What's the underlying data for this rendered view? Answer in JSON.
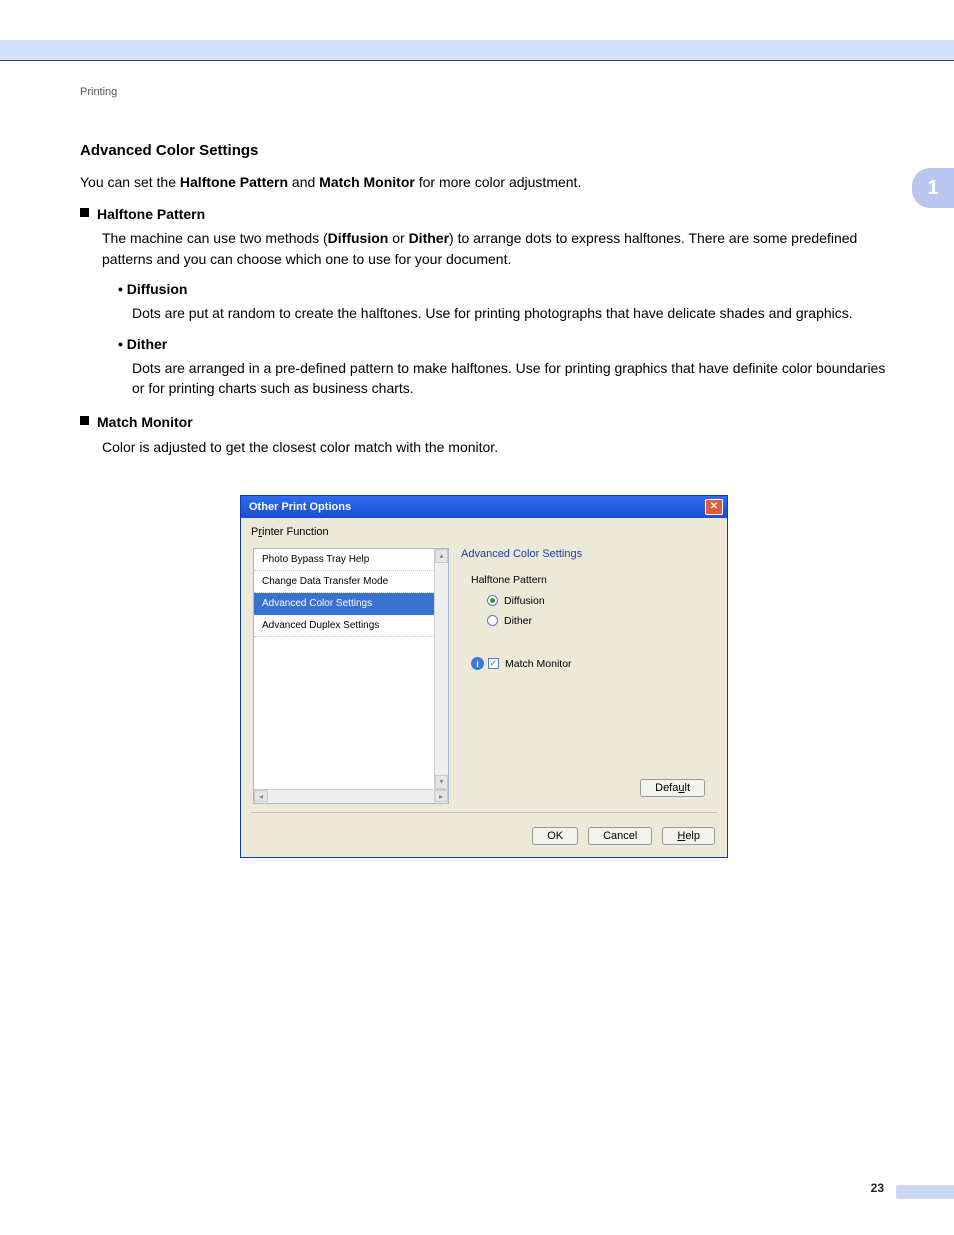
{
  "breadcrumb": "Printing",
  "chapter_badge": "1",
  "page_number": "23",
  "title": "Advanced Color Settings",
  "intro_pre": "You can set the ",
  "intro_b1": "Halftone Pattern",
  "intro_mid": " and ",
  "intro_b2": "Match Monitor",
  "intro_post": " for more color adjustment.",
  "sections": {
    "halftone": {
      "label": "Halftone Pattern",
      "body_pre": "The machine can use two methods (",
      "body_b1": "Diffusion",
      "body_mid": " or ",
      "body_b2": "Dither",
      "body_post": ") to arrange dots to express halftones. There are some predefined patterns and you can choose which one to use for your document.",
      "items": {
        "diffusion": {
          "label": "Diffusion",
          "body": "Dots are put at random to create the halftones. Use for printing photographs that have delicate shades and graphics."
        },
        "dither": {
          "label": "Dither",
          "body": "Dots are arranged in a pre-defined pattern to make halftones. Use for printing graphics that have definite color boundaries or for printing charts such as business charts."
        }
      }
    },
    "match_monitor": {
      "label": "Match Monitor",
      "body": "Color is adjusted to get the closest color match with the monitor."
    }
  },
  "dialog": {
    "title": "Other Print Options",
    "printer_function_label_pre": "P",
    "printer_function_label_ul": "r",
    "printer_function_label_post": "inter Function",
    "list": {
      "0": "Photo Bypass Tray Help",
      "1": "Change Data Transfer Mode",
      "2": "Advanced Color Settings",
      "3": "Advanced Duplex Settings"
    },
    "group_title": "Advanced Color Settings",
    "halftone_label": "Halftone Pattern",
    "radio_diffusion_pre": "Di",
    "radio_diffusion_ul": "f",
    "radio_diffusion_post": "fusion",
    "radio_dither_pre": "Di",
    "radio_dither_ul": "t",
    "radio_dither_post": "her",
    "match_monitor_ul": "M",
    "match_monitor_post": "atch Monitor",
    "buttons": {
      "default_pre": "Defa",
      "default_ul": "u",
      "default_post": "lt",
      "ok": "OK",
      "cancel": "Cancel",
      "help_ul": "H",
      "help_post": "elp"
    }
  }
}
